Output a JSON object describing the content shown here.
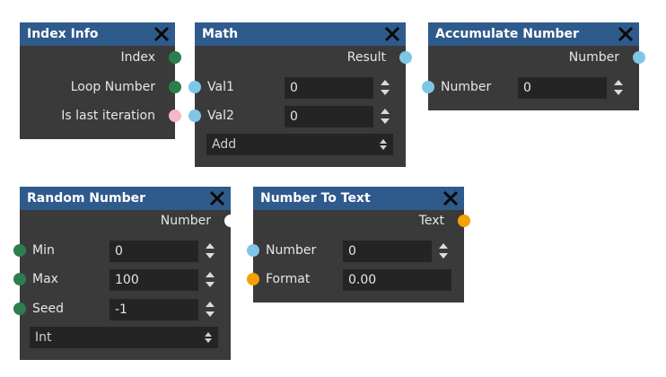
{
  "colors": {
    "node_body": "#3a3a3a",
    "node_header": "#2f5a8c",
    "field_bg": "#242424",
    "port_green": "#2e7d4f",
    "port_blue": "#7fc6e6",
    "port_pink": "#f4b8c8",
    "port_white": "#ffffff",
    "port_orange": "#f4a000"
  },
  "nodes": {
    "index_info": {
      "title": "Index Info",
      "outputs": [
        "Index",
        "Loop Number",
        "Is last iteration"
      ]
    },
    "math": {
      "title": "Math",
      "output": "Result",
      "inputs": [
        {
          "label": "Val1",
          "value": "0"
        },
        {
          "label": "Val2",
          "value": "0"
        }
      ],
      "operation": "Add"
    },
    "accumulate": {
      "title": "Accumulate Number",
      "output": "Number",
      "input": {
        "label": "Number",
        "value": "0"
      }
    },
    "random": {
      "title": "Random Number",
      "output": "Number",
      "inputs": [
        {
          "label": "Min",
          "value": "0"
        },
        {
          "label": "Max",
          "value": "100"
        },
        {
          "label": "Seed",
          "value": "-1"
        }
      ],
      "type": "Int"
    },
    "number_to_text": {
      "title": "Number To Text",
      "output": "Text",
      "inputs": [
        {
          "label": "Number",
          "value": "0"
        },
        {
          "label": "Format",
          "value": "0.00"
        }
      ]
    }
  }
}
